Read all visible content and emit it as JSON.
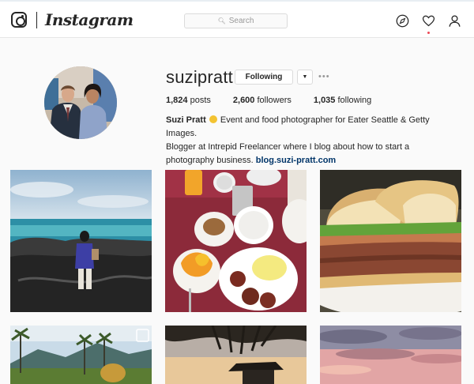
{
  "header": {
    "wordmark": "Instagram",
    "search": {
      "placeholder": "Search"
    },
    "icons": [
      "instagram-logo-icon",
      "compass-icon",
      "heart-icon",
      "person-icon"
    ]
  },
  "profile": {
    "username": "suzipratt",
    "follow_button": "Following",
    "dropdown_glyph": "▼",
    "more_glyph": "•••",
    "stats": [
      {
        "count": "1,824",
        "label": "posts"
      },
      {
        "count": "2,600",
        "label": "followers"
      },
      {
        "count": "1,035",
        "label": "following"
      }
    ],
    "bio": {
      "name": "Suzi Pratt",
      "line1": " Event and food photographer for Eater Seattle & Getty Images.",
      "line2": "Blogger at Intrepid Freelancer where I blog about how to start a photography business.",
      "link": "blog.suzi-pratt.com"
    }
  },
  "colors": {
    "link": "#003569",
    "notification": "#ed4956",
    "border": "#dbdbdb"
  },
  "posts": [
    {
      "subject": "person on lava rocks by ocean"
    },
    {
      "subject": "breakfast table with coffee and papaya"
    },
    {
      "subject": "burger sandwich close-up"
    },
    {
      "subject": "palm trees and mountains"
    },
    {
      "subject": "sunset through palm frond"
    },
    {
      "subject": "pink sunset clouds"
    }
  ]
}
